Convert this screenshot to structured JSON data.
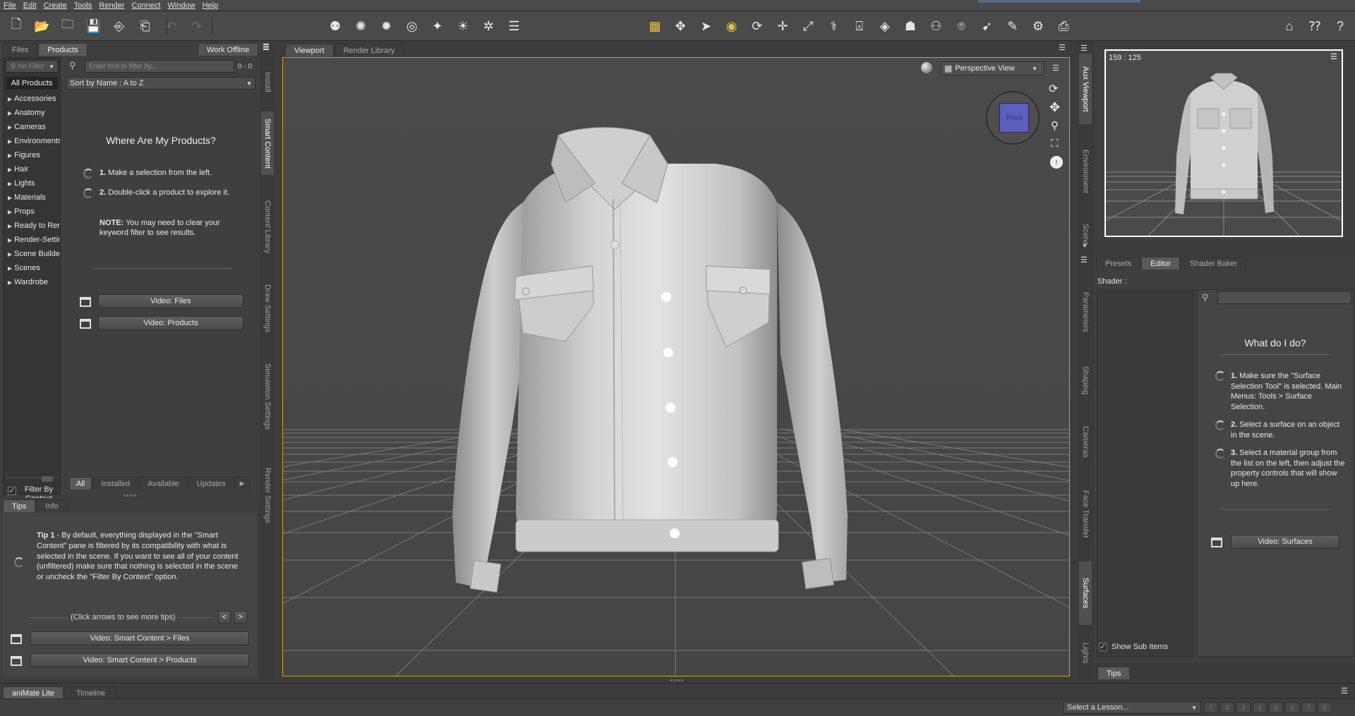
{
  "menu": [
    "File",
    "Edit",
    "Create",
    "Tools",
    "Render",
    "Connect",
    "Window",
    "Help"
  ],
  "toolbar": {
    "file_tools": [
      "new-file-icon",
      "open-file-icon",
      "merge-file-icon",
      "save-file-icon",
      "import-icon",
      "export-icon",
      "undo-icon",
      "redo-icon"
    ],
    "create_tools": [
      "new-figure-icon",
      "new-light-icon",
      "new-spotlight-icon",
      "new-camera-icon",
      "new-point-icon",
      "new-distant-icon",
      "new-null-icon",
      "align-icon"
    ],
    "view_tools": [
      "grid-icon",
      "universal-tool-icon",
      "node-select-icon",
      "active-pose-icon",
      "rotate-icon",
      "translate-icon",
      "scale-icon",
      "joint-editor-icon",
      "geometry-editor-icon",
      "surface-select-icon",
      "region-nav-icon",
      "figure-setup-icon",
      "camera-view-icon",
      "pose-tool-icon",
      "spot-render-icon",
      "render-settings-icon",
      "render-icon"
    ],
    "right_tools": [
      "home-icon",
      "whats-this-icon",
      "help-icon"
    ]
  },
  "left_panel": {
    "tabs": [
      "Files",
      "Products"
    ],
    "active_tab": "Products",
    "work_offline": "Work Offline",
    "filter_dropdown": "No Filter",
    "search_placeholder": "Enter text to filter by...",
    "count": "0 - 0",
    "all_products": "All Products",
    "sort": "Sort by Name : A to Z",
    "categories": [
      "Accessories",
      "Anatomy",
      "Cameras",
      "Environments",
      "Figures",
      "Hair",
      "Lights",
      "Materials",
      "Props",
      "Ready to Render",
      "Render-Settings",
      "Scene Builder",
      "Scenes",
      "Wardrobe"
    ],
    "heading": "Where Are My Products?",
    "step1_num": "1.",
    "step1": "Make a selection from the left.",
    "step2_num": "2.",
    "step2": "Double-click a product to explore it.",
    "note_label": "NOTE:",
    "note": "You may need to clear your keyword filter to see results.",
    "video_files": "Video: Files",
    "video_products": "Video: Products",
    "filter_by_context": "Filter By Context",
    "bottom_tabs": [
      "All",
      "Installed",
      "Available",
      "Updates"
    ],
    "vtabs": [
      "Install",
      "Smart Content",
      "Content Library",
      "Draw Settings",
      "Simulation Settings",
      "Render Settings"
    ]
  },
  "tips_panel": {
    "tabs": [
      "Tips",
      "Info"
    ],
    "tip_title": "Tip 1",
    "tip_text": " - By default, everything displayed in the \"Smart Content\" pane is filtered by its compatibility with what is selected in the scene. If you want to see all of your content (unfiltered) make sure that nothing is selected in the scene or uncheck the \"Filter By Context\" option.",
    "nav_hint": "(Click arrows to see more tips)",
    "prev": "<",
    "next": ">",
    "video1": "Video: Smart Content > Files",
    "video2": "Video: Smart Content > Products"
  },
  "viewport": {
    "tabs": [
      "Viewport",
      "Render Library"
    ],
    "active_tab": "Viewport",
    "view": "Perspective View",
    "cube_label": "Front",
    "colors": {
      "accent": "#d4a017",
      "cube": "#5a5fc0"
    }
  },
  "aux": {
    "size": "159 : 125",
    "vtabs": [
      "Aux Viewport",
      "Environment",
      "Scene"
    ]
  },
  "surfaces": {
    "tabs": [
      "Presets",
      "Editor",
      "Shader Baker"
    ],
    "active_tab": "Editor",
    "shader_label": "Shader :",
    "heading": "What do I do?",
    "step1_num": "1.",
    "step1": "Make sure the \"Surface Selection Tool\" is selected. Main Menus: Tools > Surface Selection.",
    "step2_num": "2.",
    "step2": "Select a surface on an object in the scene.",
    "step3_num": "3.",
    "step3": "Select a material group from the list on the left, then adjust the property controls that will show up here.",
    "video": "Video: Surfaces",
    "show_sub_items": "Show Sub Items",
    "tips_tab": "Tips",
    "vtabs": [
      "Parameters",
      "Shaping",
      "Cameras",
      "Face Transfer",
      "Surfaces",
      "Lights"
    ]
  },
  "bottom": {
    "tabs": [
      "aniMate Lite",
      "Timeline"
    ],
    "lesson": "Select a Lesson...",
    "steps": [
      "1",
      "2",
      "3",
      "4",
      "5",
      "6",
      "7",
      "8"
    ]
  }
}
